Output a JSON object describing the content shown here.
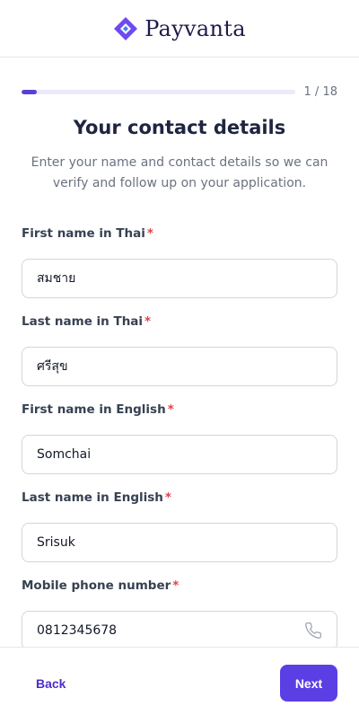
{
  "brand": {
    "name": "Payvanta",
    "accent_color": "#5b3fd4",
    "logo_icon": "diamond-logo-icon"
  },
  "progress": {
    "current": 1,
    "total": 18,
    "label": "1 / 18",
    "fraction": 0.055
  },
  "page": {
    "title": "Your contact details",
    "subtitle_line1": "Enter your name and contact details so we can",
    "subtitle_line2": "verify and follow up on your application."
  },
  "form": {
    "fields": [
      {
        "label": "First name in Thai",
        "required_mark": "*",
        "value": "สมชาย"
      },
      {
        "label": "Last name in Thai",
        "required_mark": "*",
        "value": "ศรีสุข"
      },
      {
        "label": "First name in English",
        "required_mark": "*",
        "value": "Somchai"
      },
      {
        "label": "Last name in English",
        "required_mark": "*",
        "value": "Srisuk"
      },
      {
        "label": "Mobile phone number",
        "required_mark": "*",
        "value": "0812345678",
        "icon": "phone-icon"
      }
    ]
  },
  "footer": {
    "back_label": "Back",
    "next_label": "Next"
  }
}
